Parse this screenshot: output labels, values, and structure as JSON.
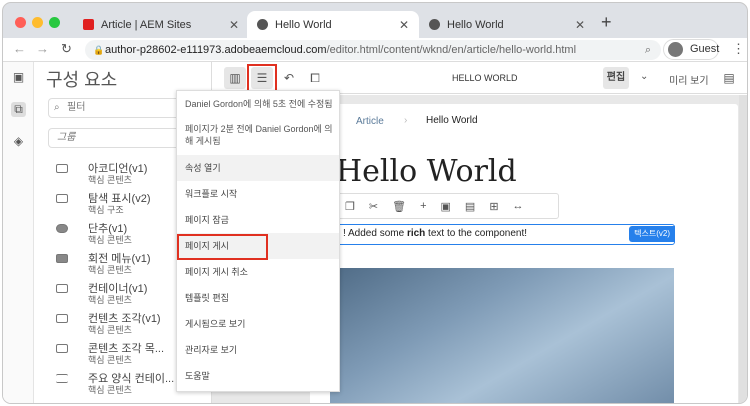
{
  "browser": {
    "tabs": [
      {
        "title": "Article | AEM Sites"
      },
      {
        "title": "Hello World"
      },
      {
        "title": "Hello World"
      }
    ],
    "url_host": "author-p28602-e111973.adobeaemcloud.com",
    "url_path": "/editor.html/content/wknd/en/article/hello-world.html",
    "profile": "Guest"
  },
  "sidebar": {
    "title": "구성 요소",
    "filter_placeholder": "필터",
    "group_placeholder": "그룹",
    "components": [
      {
        "name": "아코디언(v1)",
        "group": "핵심 콘텐츠"
      },
      {
        "name": "탐색 표시(v2)",
        "group": "핵심 구조"
      },
      {
        "name": "단추(v1)",
        "group": "핵심 콘텐츠"
      },
      {
        "name": "회전 메뉴(v1)",
        "group": "핵심 콘텐츠"
      },
      {
        "name": "컨테이너(v1)",
        "group": "핵심 콘텐츠"
      },
      {
        "name": "컨텐츠 조각(v1)",
        "group": "핵심 콘텐츠"
      },
      {
        "name": "콘텐츠 조각 목...",
        "group": "핵심 콘텐츠"
      },
      {
        "name": "주요 양식 컨테이...",
        "group": "핵심 콘텐츠"
      }
    ]
  },
  "toolbar": {
    "page_title": "HELLO WORLD",
    "edit": "편집",
    "preview": "미리 보기"
  },
  "menu": {
    "status1": "Daniel Gordon에 의해 5초 전에 수정됨",
    "status2": "페이지가 2분 전에 Daniel Gordon에 의해 게시됨",
    "items": [
      "속성 열기",
      "워크플로 시작",
      "페이지 잠금",
      "페이지 게시",
      "페이지 게시 취소",
      "템플릿 편집",
      "게시됨으로 보기",
      "관리자로 보기",
      "도움말"
    ]
  },
  "page": {
    "breadcrumb": [
      "Article",
      "Hello World"
    ],
    "heading": "Hello World",
    "text_pre": "! Added some ",
    "text_bold": "rich",
    "text_post": " text to the component!",
    "component_badge": "텍스트(v2)"
  },
  "colors": {
    "highlight": "#e03020",
    "accent": "#2680eb"
  }
}
